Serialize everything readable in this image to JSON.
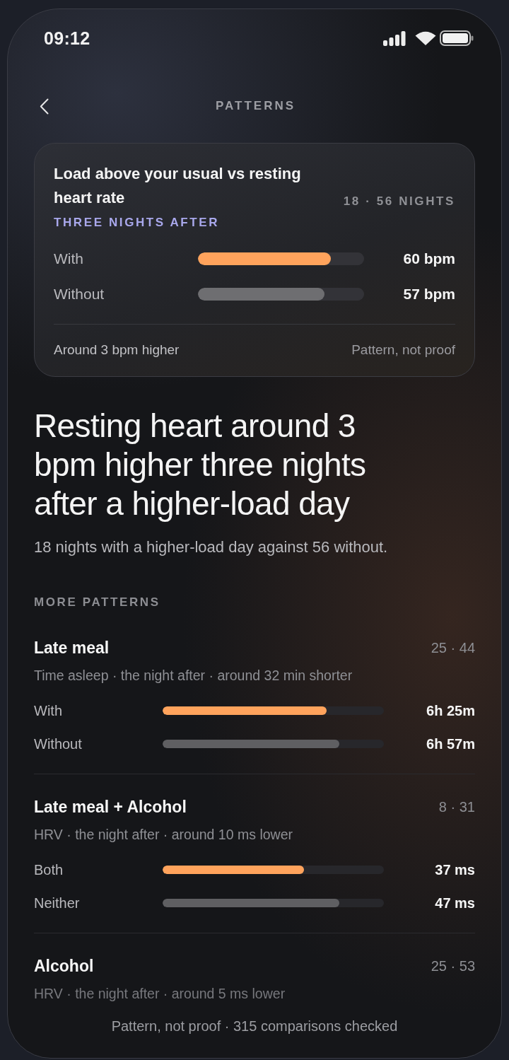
{
  "status_bar": {
    "time": "09:12"
  },
  "header": {
    "title": "PATTERNS"
  },
  "card": {
    "title": "Load above your usual vs resting heart rate",
    "counts": "18 · 56 NIGHTS",
    "timing": "THREE NIGHTS AFTER",
    "bars": [
      {
        "label": "With",
        "value": "60 bpm",
        "level": 0.8,
        "color": "#ffa35c"
      },
      {
        "label": "Without",
        "value": "57 bpm",
        "level": 0.76,
        "color": "#6e6e71"
      }
    ],
    "summary": "Around 3 bpm higher",
    "caveat": "Pattern, not proof"
  },
  "headline": "Resting heart around 3 bpm higher three nights after a higher-load day",
  "subheadline": "18 nights with a higher-load day against 56 without.",
  "more_patterns": {
    "heading": "MORE PATTERNS",
    "items": [
      {
        "title": "Late meal",
        "counts": "25 · 44",
        "detail": "Time asleep · the night after · around 32 min shorter",
        "bars": [
          {
            "label": "With",
            "value": "6h 25m",
            "level": 0.74,
            "color": "#ffa35c"
          },
          {
            "label": "Without",
            "value": "6h 57m",
            "level": 0.8,
            "color": "#5f5f62"
          }
        ]
      },
      {
        "title": "Late meal + Alcohol",
        "counts": "8 · 31",
        "detail": "HRV · the night after · around 10 ms lower",
        "bars": [
          {
            "label": "Both",
            "value": "37 ms",
            "level": 0.64,
            "color": "#ffa35c"
          },
          {
            "label": "Neither",
            "value": "47 ms",
            "level": 0.8,
            "color": "#5f5f62"
          }
        ]
      },
      {
        "title": "Alcohol",
        "counts": "25 · 53",
        "detail": "HRV · the night after · around 5 ms lower"
      }
    ]
  },
  "footer": "Pattern, not proof · 315 comparisons checked"
}
